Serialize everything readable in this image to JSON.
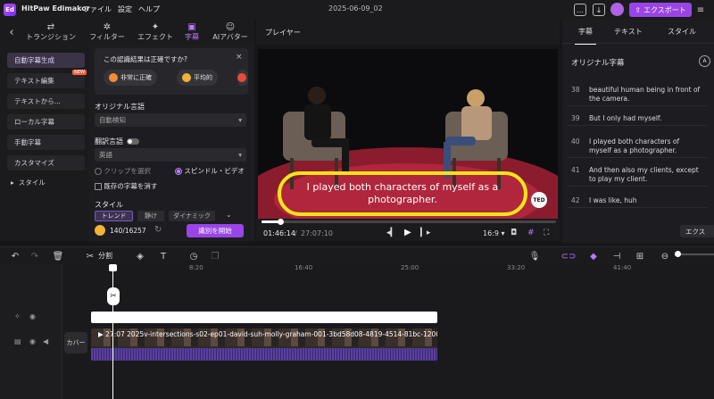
{
  "app": {
    "name": "HitPaw Edimakor",
    "menu": [
      "ファイル",
      "設定",
      "ヘルプ"
    ],
    "project_title": "2025-06-09_02",
    "export_label": "エクスポート",
    "logo_text": "Ed"
  },
  "top_tabs": [
    {
      "label": "トランジション",
      "icon": "transition-icon"
    },
    {
      "label": "フィルター",
      "icon": "filter-icon"
    },
    {
      "label": "エフェクト",
      "icon": "effect-icon"
    },
    {
      "label": "字幕",
      "icon": "subtitle-icon",
      "active": true
    },
    {
      "label": "AIアバター",
      "icon": "ai-avatar-icon"
    }
  ],
  "left_nav": {
    "items": [
      "自動字幕生成",
      "テキスト編集",
      "テキストから...",
      "ローカル字幕",
      "手動字幕",
      "カスタマイズ",
      "スタイル"
    ],
    "active_index": 0,
    "new_badge": "NEW"
  },
  "subtitle_panel": {
    "survey_question": "この認識結果は正確ですか?",
    "survey_options": [
      "非常に正確",
      "平均的"
    ],
    "original_language_label": "オリジナル言語",
    "original_language_value": "自動検知",
    "translation_label": "翻訳言語",
    "translation_value": "英語",
    "radio_clip": "クリップを選択",
    "radio_video": "スピンドル・ビデオ",
    "checkbox_clear": "既存の字幕を消す",
    "style_label": "スタイル",
    "style_tabs": [
      "トレンド",
      "静け",
      "ダイナミック"
    ],
    "credits": "140/16257",
    "start_button": "識別を開始"
  },
  "player": {
    "header": "プレイヤー",
    "subtitle_text": "I played both characters of myself as a photographer.",
    "ted_logo": "TED",
    "current_time": "01:46:14",
    "total_time": "27:07:10",
    "aspect_ratio": "16:9",
    "progress_fraction": 0.065
  },
  "right_panel": {
    "tabs": [
      "字幕",
      "テキスト",
      "スタイル"
    ],
    "active_tab": 0,
    "title": "オリジナル字幕",
    "subtitles": [
      {
        "num": "38",
        "text": "beautiful human being in front of the camera."
      },
      {
        "num": "39",
        "text": "But I only had myself."
      },
      {
        "num": "40",
        "text": "I played both characters of myself as a photographer."
      },
      {
        "num": "41",
        "text": "And then also my clients, except to play my client."
      },
      {
        "num": "42",
        "text": "I was like, huh"
      }
    ],
    "export_partial": "エクス"
  },
  "toolbar": {
    "split_label": "分割"
  },
  "timeline": {
    "ticks": [
      "8:20",
      "16:40",
      "25:00",
      "33:20",
      "41:40"
    ],
    "cover_label": "カバー",
    "clip_name": "27:07 2025v-intersections-s02-ep01-david-suh-molly-graham-001-3bd58d08-4819-4514-81bc-1200"
  },
  "colors": {
    "accent": "#9a44e8",
    "highlight": "#f2e41a",
    "background": "#161618"
  }
}
